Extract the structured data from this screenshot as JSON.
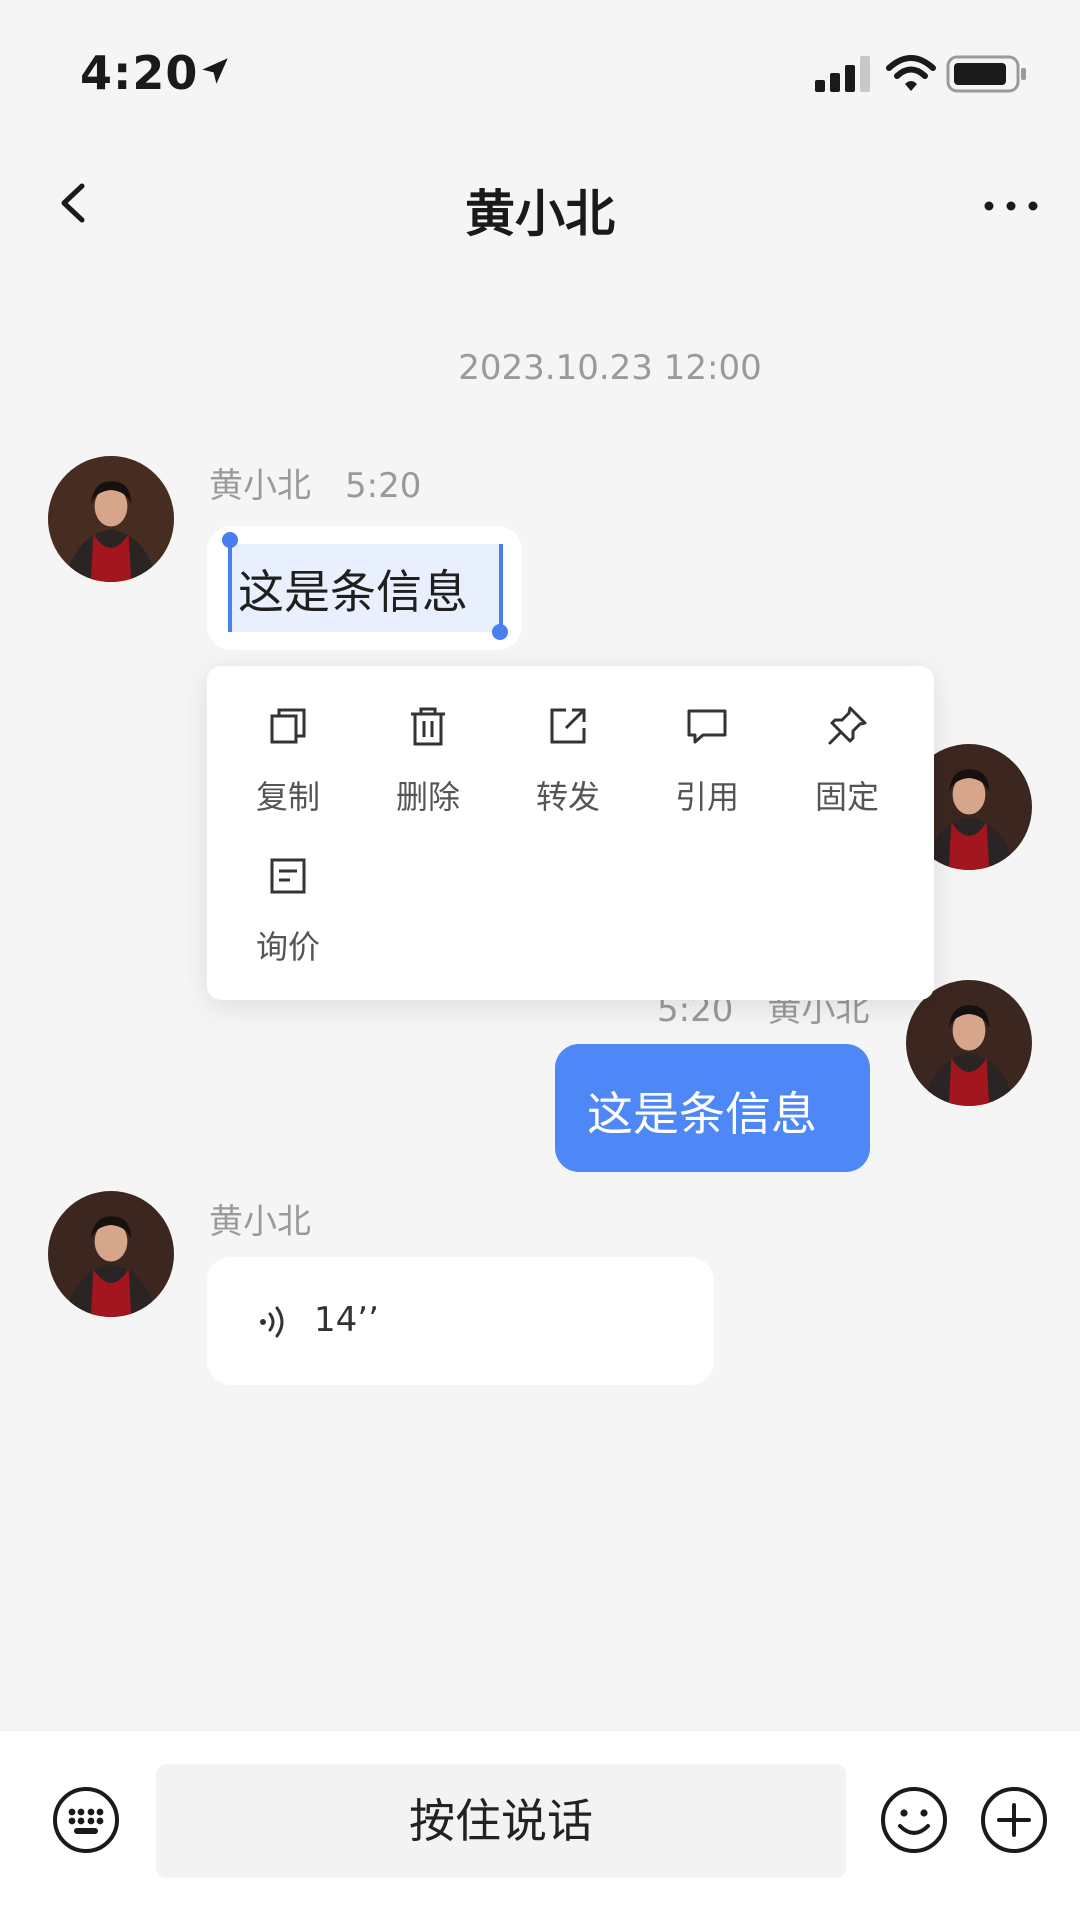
{
  "status_bar": {
    "time": "4:20"
  },
  "nav": {
    "title": "黄小北"
  },
  "chat": {
    "timestamp": "2023.10.23 12:00",
    "messages": [
      {
        "sender": "黄小北",
        "time": "5:20",
        "text": "这是条信息"
      },
      {
        "sender": "黄小北",
        "time": "5:20",
        "text": "这是条信息"
      },
      {
        "sender": "黄小北",
        "voice_duration": "14’’"
      }
    ]
  },
  "context_menu": {
    "items": [
      {
        "label": "复制",
        "icon": "copy-icon"
      },
      {
        "label": "删除",
        "icon": "trash-icon"
      },
      {
        "label": "转发",
        "icon": "forward-icon"
      },
      {
        "label": "引用",
        "icon": "quote-icon"
      },
      {
        "label": "固定",
        "icon": "pin-icon"
      },
      {
        "label": "询价",
        "icon": "inquiry-icon"
      }
    ]
  },
  "input_bar": {
    "voice_button_label": "按住说话"
  },
  "colors": {
    "accent": "#4e87f6",
    "selection": "#e8effd",
    "background": "#f5f5f5"
  }
}
